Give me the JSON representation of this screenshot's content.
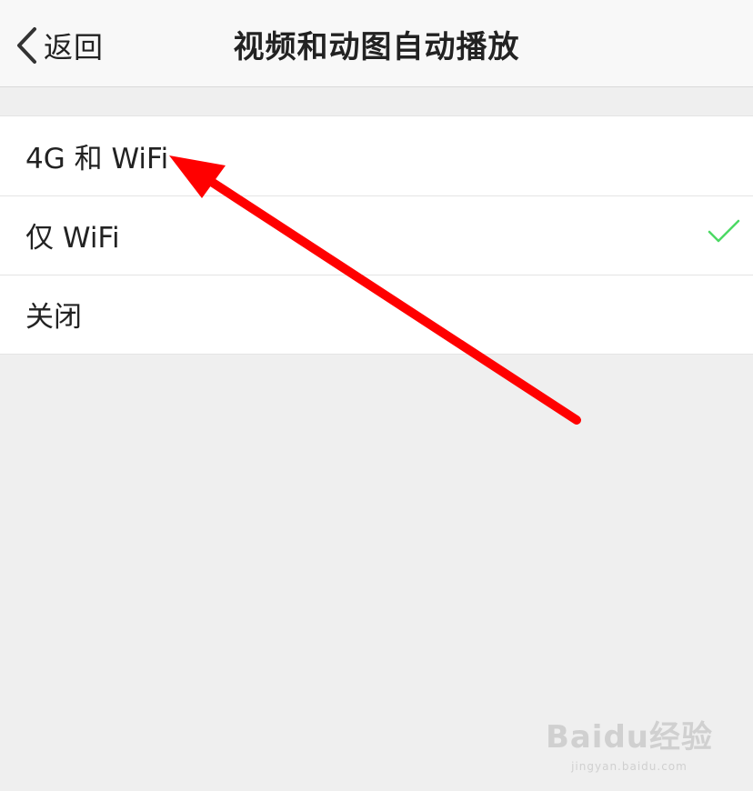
{
  "navbar": {
    "back_label": "返回",
    "title": "视频和动图自动播放"
  },
  "options": [
    {
      "label": "4G 和 WiFi",
      "selected": false
    },
    {
      "label": "仅 WiFi",
      "selected": true
    },
    {
      "label": "关闭",
      "selected": false
    }
  ],
  "watermark": {
    "brand": "Baidu经验",
    "url": "jingyan.baidu.com"
  },
  "colors": {
    "check": "#4cd964",
    "annotation_arrow": "#ff0000",
    "background": "#efefef"
  },
  "icons": {
    "back": "chevron-left-icon",
    "selected": "check-icon"
  }
}
